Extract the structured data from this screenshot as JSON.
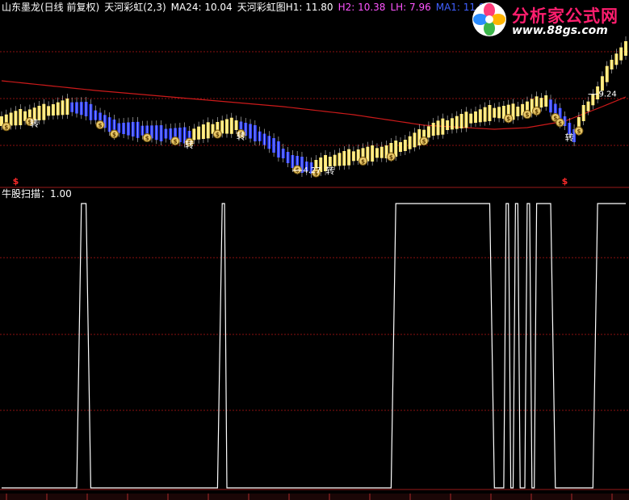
{
  "header": {
    "stock_label": "山东墨龙(日线 前复权)",
    "indicator1": "天河彩虹(2,3)",
    "ma24_label": "MA24: 10.04",
    "indicator2_h1": "天河彩虹图H1: 11.80",
    "h2_label": "H2: 10.38",
    "lh_label": "LH: 7.96",
    "ma1_label": "MA1: 11.97"
  },
  "colors": {
    "bg": "#000000",
    "header_white": "#ffffff",
    "h2": "#ff55ff",
    "lh": "#ff55ff",
    "ma1": "#4060ff",
    "ma_line": "#cc1a1a",
    "band_yellow": "#ffe66a",
    "band_blue": "#2a3cff",
    "grid": "#8b1010",
    "signal_line": "#ffffff",
    "dollar_red": "#ff2a2a"
  },
  "logo": {
    "name": "分析家公式网",
    "url": "www.88gs.com",
    "mark_icon": "flower-logo-icon"
  },
  "main_chart": {
    "type": "line",
    "price_annotations": [
      {
        "text": "4.27",
        "index": 62
      },
      {
        "text": "9.24",
        "index": 125
      }
    ],
    "turn_label": "转",
    "turn_markers": [
      7,
      40,
      51,
      70,
      121
    ],
    "money_bag_markers": [
      1,
      6,
      21,
      24,
      31,
      37,
      40,
      46,
      51,
      63,
      67,
      77,
      83,
      90,
      108,
      112,
      114,
      118,
      119,
      123
    ],
    "dollar_signs": [
      3,
      120
    ]
  },
  "sub_chart": {
    "title": "牛股扫描：1.00",
    "type": "step",
    "ylim": [
      0,
      1
    ],
    "segments": [
      [
        0,
        0
      ],
      [
        16,
        0
      ],
      [
        17,
        1
      ],
      [
        18,
        1
      ],
      [
        19,
        0
      ],
      [
        46,
        0
      ],
      [
        47,
        1
      ],
      [
        47.5,
        1
      ],
      [
        48,
        0
      ],
      [
        83,
        0
      ],
      [
        84,
        1
      ],
      [
        104,
        1
      ],
      [
        105,
        0
      ],
      [
        107,
        0
      ],
      [
        107.5,
        1
      ],
      [
        108,
        1
      ],
      [
        108.5,
        0
      ],
      [
        109,
        0
      ],
      [
        109.5,
        1
      ],
      [
        110,
        1
      ],
      [
        110.5,
        0
      ],
      [
        111.5,
        0
      ],
      [
        112,
        1
      ],
      [
        112.5,
        1
      ],
      [
        113,
        0
      ],
      [
        113.5,
        0
      ],
      [
        114,
        1
      ],
      [
        117,
        1
      ],
      [
        118,
        0
      ],
      [
        126,
        0
      ],
      [
        127,
        1
      ],
      [
        133,
        1
      ]
    ]
  }
}
